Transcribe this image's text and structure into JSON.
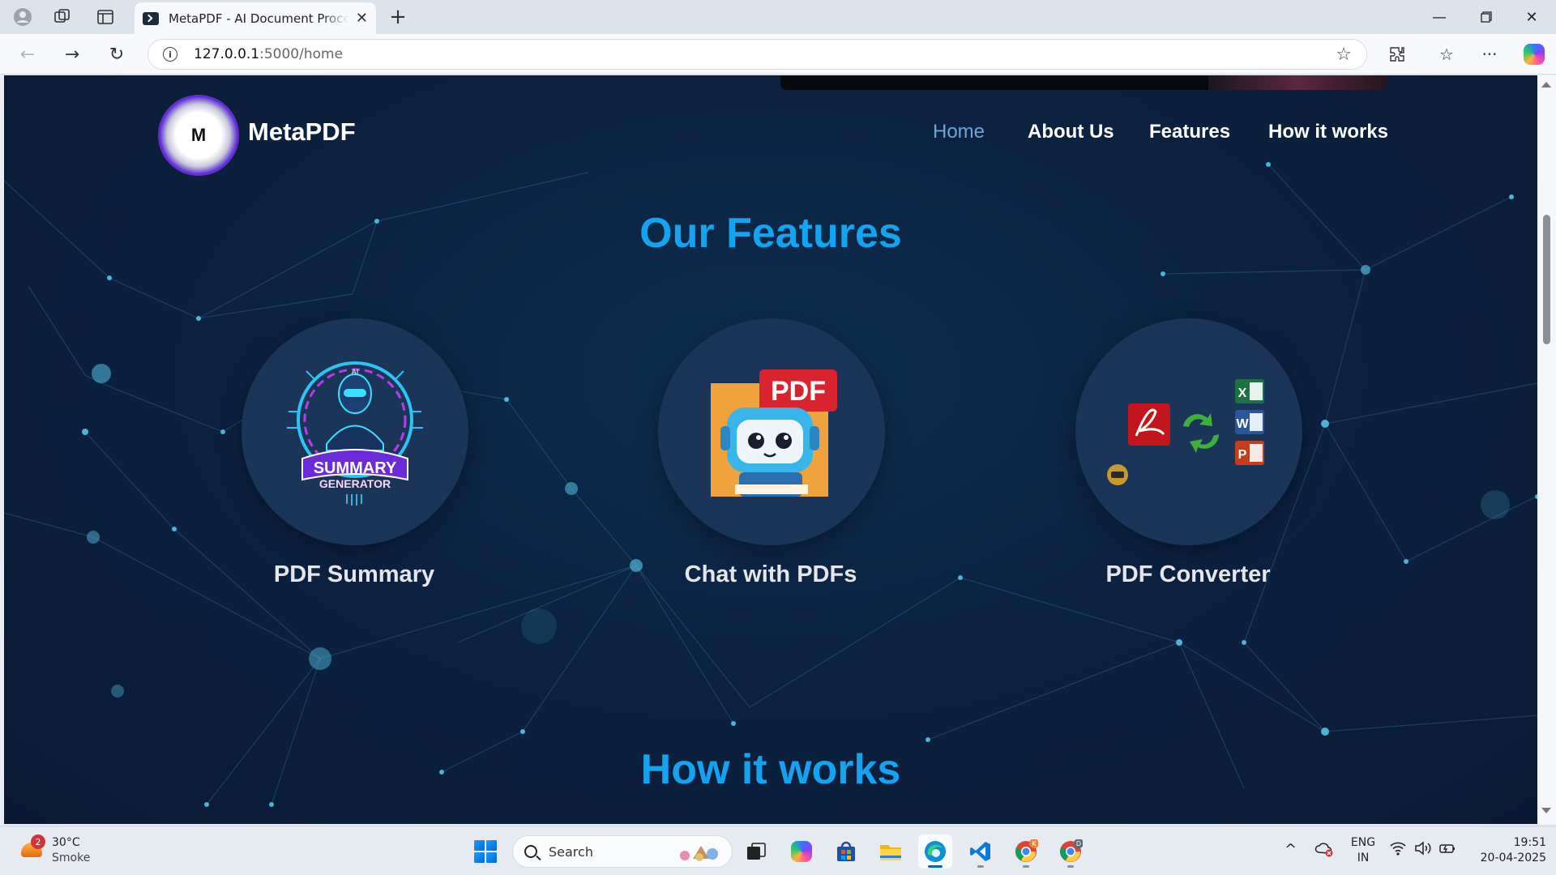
{
  "browser": {
    "tab_title": "MetaPDF - AI Document Processing",
    "url_host": "127.0.0.1",
    "url_path": ":5000/home",
    "new_tab_icon": "plus-icon"
  },
  "site": {
    "logo_letter": "M",
    "brand": "MetaPDF",
    "nav": [
      {
        "label": "Home",
        "active": true
      },
      {
        "label": "About Us",
        "active": false
      },
      {
        "label": "Features",
        "active": false
      },
      {
        "label": "How it works",
        "active": false
      }
    ],
    "features_title": "Our Features",
    "features": [
      {
        "label": "PDF Summary",
        "badge_line1": "SUMMARY",
        "badge_line2": "GENERATOR",
        "robot_tag": "AI"
      },
      {
        "label": "Chat with PDFs",
        "badge": "PDF"
      },
      {
        "label": "PDF Converter",
        "formats": [
          "X",
          "W",
          "P"
        ]
      }
    ],
    "how_title": "How it works"
  },
  "taskbar": {
    "weather_badge": "2",
    "temperature": "30°C",
    "condition": "Smoke",
    "search_placeholder": "Search",
    "lang_line1": "ENG",
    "lang_line2": "IN",
    "time": "19:51",
    "date": "20-04-2025",
    "chrome_badges": [
      "K",
      "D"
    ]
  },
  "colors": {
    "accent_title": "#14a3f0",
    "page_bg": "#0b2240",
    "nav_active": "#6fa5d6",
    "feature_circle": "#1b3558"
  }
}
